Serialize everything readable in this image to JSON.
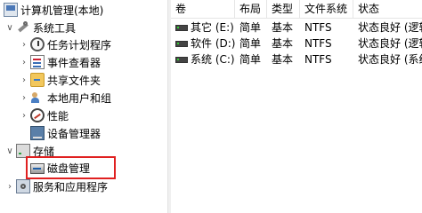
{
  "tree": {
    "root": {
      "label": "计算机管理(本地)",
      "icon": "computer-management-icon"
    },
    "system_tools": {
      "label": "系统工具",
      "icon": "tools-icon",
      "expanded": true
    },
    "items": [
      {
        "label": "任务计划程序",
        "icon": "clock-icon"
      },
      {
        "label": "事件查看器",
        "icon": "event-viewer-icon"
      },
      {
        "label": "共享文件夹",
        "icon": "shared-folder-icon"
      },
      {
        "label": "本地用户和组",
        "icon": "users-icon"
      },
      {
        "label": "性能",
        "icon": "performance-icon"
      },
      {
        "label": "设备管理器",
        "icon": "device-manager-icon"
      }
    ],
    "storage": {
      "label": "存储",
      "icon": "storage-icon",
      "expanded": true
    },
    "disk_management": {
      "label": "磁盘管理",
      "icon": "disk-icon",
      "highlight_color": "#e02020"
    },
    "services": {
      "label": "服务和应用程序",
      "icon": "services-icon"
    }
  },
  "list": {
    "columns": [
      "卷",
      "布局",
      "类型",
      "文件系统",
      "状态"
    ],
    "rows": [
      {
        "volume": "其它 (E:)",
        "layout": "简单",
        "type": "基本",
        "fs": "NTFS",
        "status": "状态良好 (逻辑"
      },
      {
        "volume": "软件 (D:)",
        "layout": "简单",
        "type": "基本",
        "fs": "NTFS",
        "status": "状态良好 (逻辑"
      },
      {
        "volume": "系统 (C:)",
        "layout": "简单",
        "type": "基本",
        "fs": "NTFS",
        "status": "状态良好 (系统"
      }
    ]
  }
}
